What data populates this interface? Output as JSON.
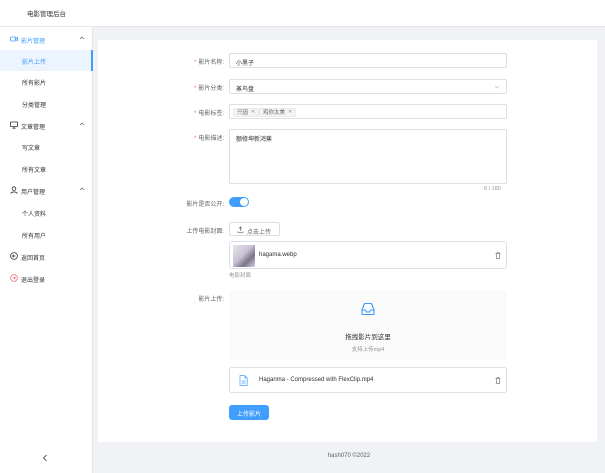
{
  "header": {
    "title": "电影管理后台"
  },
  "sidebar": {
    "groups": [
      {
        "label": "影片管理",
        "items": [
          "影片上传",
          "所有影片",
          "分类管理"
        ]
      },
      {
        "label": "文章管理",
        "items": [
          "写文章",
          "所有文章"
        ]
      },
      {
        "label": "用户管理",
        "items": [
          "个人资料",
          "所有用户"
        ]
      }
    ],
    "singles": [
      "返回首页",
      "退出登录"
    ],
    "active_item": "影片上传"
  },
  "form": {
    "name": {
      "label": "影片名称:",
      "value": "小黑子"
    },
    "category": {
      "label": "影片分类:",
      "value": "蒸鸟盘"
    },
    "tags": {
      "label": "电影标签:",
      "values": [
        "只因",
        "鸡你太美"
      ]
    },
    "description": {
      "label": "电影描述:",
      "value": "额修坤新鸿蕉",
      "counter": "6 / 180"
    },
    "public": {
      "label": "影片是否公开:",
      "on": true
    },
    "cover": {
      "label": "上传电影封面:",
      "button": "点击上传",
      "file_name": "hagama.webp",
      "caption": "电影封面"
    },
    "video": {
      "label": "影片上传:",
      "drag_text": "拖拽影片到这里",
      "tip": "支持上传mp4",
      "file_name": "Haganma - Compressed with FlexClip.mp4"
    },
    "submit": "上传影片"
  },
  "footer": {
    "text": "hash070 ©2022"
  },
  "colors": {
    "accent": "#409eff",
    "required": "#f56c6c",
    "background": "#f0f2f5"
  }
}
